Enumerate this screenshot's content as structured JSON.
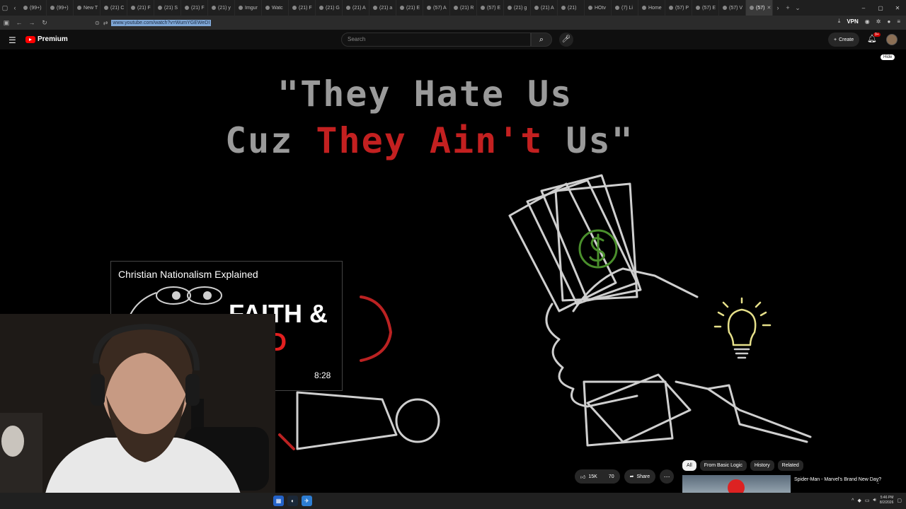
{
  "tabs": [
    "(99+)",
    "(99+)",
    "New T",
    "(21) C",
    "(21) F",
    "(21) S",
    "(21) F",
    "(21) y",
    "Imgur",
    "Watc",
    "(21) F",
    "(21) G",
    "(21) A",
    "(21) a",
    "(21) E",
    "(57) A",
    "(21) R",
    "(57) E",
    "(21) g",
    "(21) A",
    "(21)",
    "HOtv",
    "(7) Li",
    "Home",
    "(57) P",
    "(57) E",
    "(57) V",
    "(57)"
  ],
  "address": {
    "url": "www.youtube.com/watch?v=WumYGEWeDI",
    "vpn": "VPN"
  },
  "youtube": {
    "brand": "Premium",
    "search_placeholder": "Search",
    "create_label": "Create",
    "notif_count": "9+",
    "hide_label": "Hide"
  },
  "video": {
    "line1": "\"They Hate Us",
    "line2_a": "Cuz ",
    "line2_b": "They Ain't",
    "line2_c": " Us\""
  },
  "endcard": {
    "title": "Christian Nationalism Explained",
    "big_line1": "FAITH &",
    "big_line2": "OOD",
    "duration": "8:28"
  },
  "actions": {
    "likes": "15K",
    "dislikes": "70",
    "share": "Share"
  },
  "chips": [
    "All",
    "From Basic Logic",
    "History",
    "Related"
  ],
  "recommendation": {
    "title": "Spider-Man - Marvel's Brand New Day?"
  },
  "clock": {
    "time": "5:46 PM",
    "date": "8/2/2026"
  }
}
